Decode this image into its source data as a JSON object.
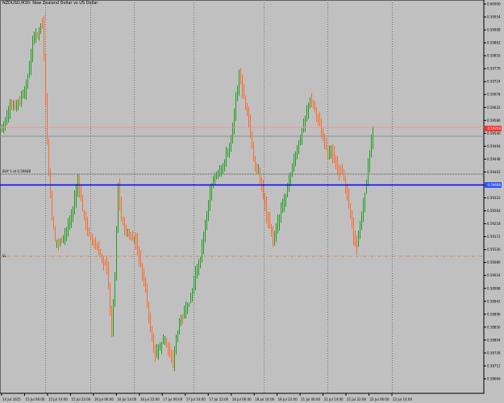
{
  "header": {
    "title": "NZDUSD,M30: New Zealand Dollar vs US Dollar"
  },
  "lines": {
    "position_label": "BUY 1 at 0.59688",
    "sl_label": "SL",
    "position_price": "0.59688",
    "bid_price": "0.59764",
    "stop_price": "0.59688",
    "colors": {
      "red_line": "#f09090",
      "blue_line": "#0000ff",
      "sl_line": "#e08060",
      "bull": "#1ea01e",
      "bear": "#ff6a2a",
      "badge_red": "#ff3030",
      "badge_blue": "#2a50ff"
    }
  },
  "price_axis": {
    "labels": [
      "0.60000",
      "0.59954",
      "0.59908",
      "0.59862",
      "0.59816",
      "0.59770",
      "0.59724",
      "0.59678",
      "0.59632",
      "0.59586",
      "0.59540",
      "0.59494",
      "0.59448",
      "0.59402",
      "0.59356",
      "0.59310",
      "0.59264",
      "0.59218",
      "0.59172",
      "0.59126",
      "0.59080",
      "0.59034",
      "0.58988",
      "0.58942",
      "0.58896",
      "0.58850",
      "0.58804",
      "0.58758",
      "0.58712",
      "0.58666"
    ]
  },
  "time_axis": {
    "labels": [
      "14 Jul 2025",
      "15 Jul 06:00",
      "15 Jul 14:00",
      "15 Jul 22:00",
      "16 Jul 06:00",
      "16 Jul 14:00",
      "16 Jul 22:00",
      "17 Jul 06:00",
      "17 Jul 14:00",
      "17 Jul 22:00",
      "18 Jul 06:00",
      "18 Jul 14:00",
      "18 Jul 22:00",
      "21 Jul 06:00",
      "21 Jul 14:00",
      "21 Jul 22:00",
      "22 Jul 06:00",
      "22 Jul 14:00"
    ]
  },
  "icons": {
    "grid": "dotted-grid"
  }
}
